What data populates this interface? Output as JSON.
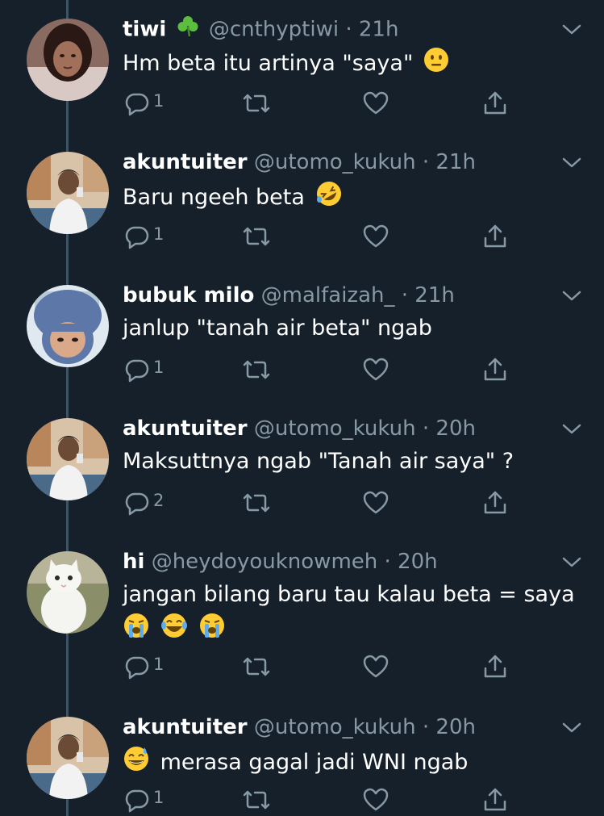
{
  "colors": {
    "background": "#15202b",
    "text": "#ffffff",
    "muted": "#8899a6",
    "thread_line": "#3d5466"
  },
  "tweets": [
    {
      "name": "tiwi",
      "handle": "@cnthyptiwi",
      "dot": "·",
      "time": "21h",
      "text": "Hm beta itu artinya \"saya\"",
      "name_emoji": "shamrock-emoji",
      "text_emoji": "neutral-face-emoji",
      "replies": "1"
    },
    {
      "name": "akuntuiter",
      "handle": "@utomo_kukuh",
      "dot": "·",
      "time": "21h",
      "text": "Baru ngeeh beta",
      "text_emoji": "rofl-emoji",
      "replies": "1"
    },
    {
      "name": "bubuk milo",
      "handle": "@malfaizah_",
      "dot": "·",
      "time": "21h",
      "text": "janlup \"tanah air beta\" ngab",
      "replies": "1"
    },
    {
      "name": "akuntuiter",
      "handle": "@utomo_kukuh",
      "dot": "·",
      "time": "20h",
      "text": "Maksuttnya ngab \"Tanah air saya\" ?",
      "replies": "2"
    },
    {
      "name": "hi",
      "handle": "@heydoyouknowmeh",
      "dot": "·",
      "time": "20h",
      "text": "jangan bilang baru tau kalau beta = saya",
      "line2_emojis": [
        "loudly-crying-emoji",
        "tears-of-joy-emoji",
        "loudly-crying-emoji"
      ],
      "replies": "1"
    },
    {
      "name": "akuntuiter",
      "handle": "@utomo_kukuh",
      "dot": "·",
      "time": "20h",
      "text": "merasa gagal jadi WNI ngab",
      "text_emoji_lead": "grinning-sweat-emoji",
      "replies": "1"
    }
  ]
}
